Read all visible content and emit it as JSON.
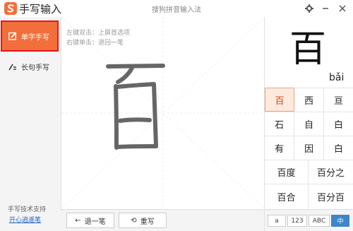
{
  "app": {
    "title": "手写输入",
    "ime_name": "搜狗拼音输入法"
  },
  "sidebar": {
    "modes": [
      {
        "label": "单字手写",
        "active": true
      },
      {
        "label": "长句手写",
        "active": false
      }
    ],
    "support_text": "手写技术支持",
    "support_link": "开心逍遥笔"
  },
  "canvas": {
    "hints": [
      "左键双击：上屏首选项",
      "右键单击：退回一笔"
    ]
  },
  "bottom": {
    "undo_label": "退一笔",
    "rewrite_label": "重写"
  },
  "preview": {
    "char": "百",
    "pinyin": "bǎi"
  },
  "candidates": {
    "row1": [
      "百",
      "西",
      "亘"
    ],
    "row2": [
      "石",
      "自",
      "白"
    ],
    "row3": [
      "有",
      "因",
      "白"
    ],
    "row4": [
      "百度",
      "百分之"
    ],
    "row5": [
      "百合",
      "百分百"
    ]
  },
  "keyboard_modes": [
    "a",
    "123",
    "ABC",
    "中"
  ],
  "colors": {
    "accent": "#f26f3c",
    "highlight_border": "#e8141b",
    "selected_candidate": "#fde9dd",
    "active_kb": "#3f86c9"
  }
}
